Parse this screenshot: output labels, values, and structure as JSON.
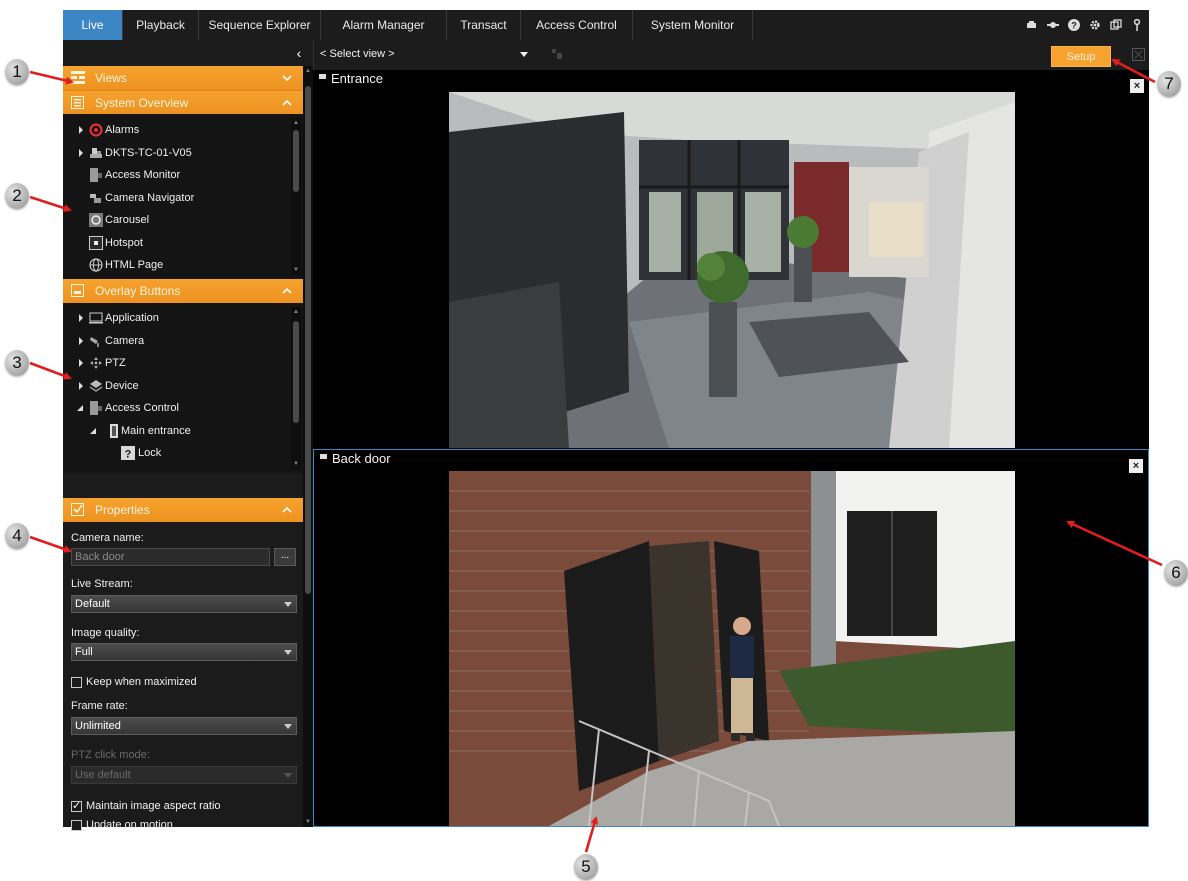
{
  "tabs": [
    {
      "label": "Live",
      "active": true
    },
    {
      "label": "Playback",
      "active": false
    },
    {
      "label": "Sequence Explorer",
      "active": false
    },
    {
      "label": "Alarm Manager",
      "active": false
    },
    {
      "label": "Transact",
      "active": false
    },
    {
      "label": "Access Control",
      "active": false
    },
    {
      "label": "System Monitor",
      "active": false
    }
  ],
  "toolbar_icons": [
    "camera-connect-icon",
    "network-icon",
    "help-icon",
    "settings-icon",
    "window-icon",
    "key-icon"
  ],
  "panels": {
    "views": {
      "title": "Views"
    },
    "system_overview": {
      "title": "System Overview",
      "items": [
        {
          "label": "Alarms",
          "icon": "alarm-icon",
          "expandable": true
        },
        {
          "label": "DKTS-TC-01-V05",
          "icon": "server-icon",
          "expandable": true
        },
        {
          "label": "Access Monitor",
          "icon": "door-icon",
          "expandable": false
        },
        {
          "label": "Camera Navigator",
          "icon": "camera-navigator-icon",
          "expandable": false
        },
        {
          "label": "Carousel",
          "icon": "carousel-icon",
          "expandable": false
        },
        {
          "label": "Hotspot",
          "icon": "hotspot-icon",
          "expandable": false
        },
        {
          "label": "HTML Page",
          "icon": "globe-icon",
          "expandable": false
        }
      ]
    },
    "overlay_buttons": {
      "title": "Overlay Buttons",
      "items": [
        {
          "label": "Application",
          "icon": "monitor-icon",
          "expandable": true,
          "level": 0
        },
        {
          "label": "Camera",
          "icon": "camera-icon",
          "expandable": true,
          "level": 0
        },
        {
          "label": "PTZ",
          "icon": "ptz-icon",
          "expandable": true,
          "level": 0
        },
        {
          "label": "Device",
          "icon": "device-icon",
          "expandable": true,
          "level": 0
        },
        {
          "label": "Access Control",
          "icon": "door-icon",
          "expanded": true,
          "level": 0
        },
        {
          "label": "Main entrance",
          "icon": "door-icon",
          "expanded": true,
          "level": 1
        },
        {
          "label": "Lock",
          "icon": "help-icon",
          "level": 2
        }
      ]
    },
    "properties": {
      "title": "Properties",
      "camera_name_label": "Camera name:",
      "camera_name_value": "Back door",
      "browse_label": "...",
      "live_stream_label": "Live Stream:",
      "live_stream_value": "Default",
      "image_quality_label": "Image quality:",
      "image_quality_value": "Full",
      "keep_maximized_label": "Keep when maximized",
      "keep_maximized_checked": false,
      "frame_rate_label": "Frame rate:",
      "frame_rate_value": "Unlimited",
      "ptz_click_label": "PTZ click mode:",
      "ptz_click_value": "Use default",
      "aspect_ratio_label": "Maintain image aspect ratio",
      "aspect_ratio_checked": true,
      "update_motion_label": "Update on motion",
      "update_motion_checked": false
    }
  },
  "viewbar": {
    "select_view": "< Select view >",
    "setup_label": "Setup"
  },
  "cameras": [
    {
      "title": "Entrance"
    },
    {
      "title": "Back door",
      "selected": true
    }
  ],
  "close_glyph": "×",
  "collapse_glyph": "‹",
  "callouts": [
    "1",
    "2",
    "3",
    "4",
    "5",
    "6",
    "7"
  ],
  "colors": {
    "accent": "#3d86c6",
    "panel_header": "#f6a22e",
    "arrow": "#e11d1d"
  }
}
